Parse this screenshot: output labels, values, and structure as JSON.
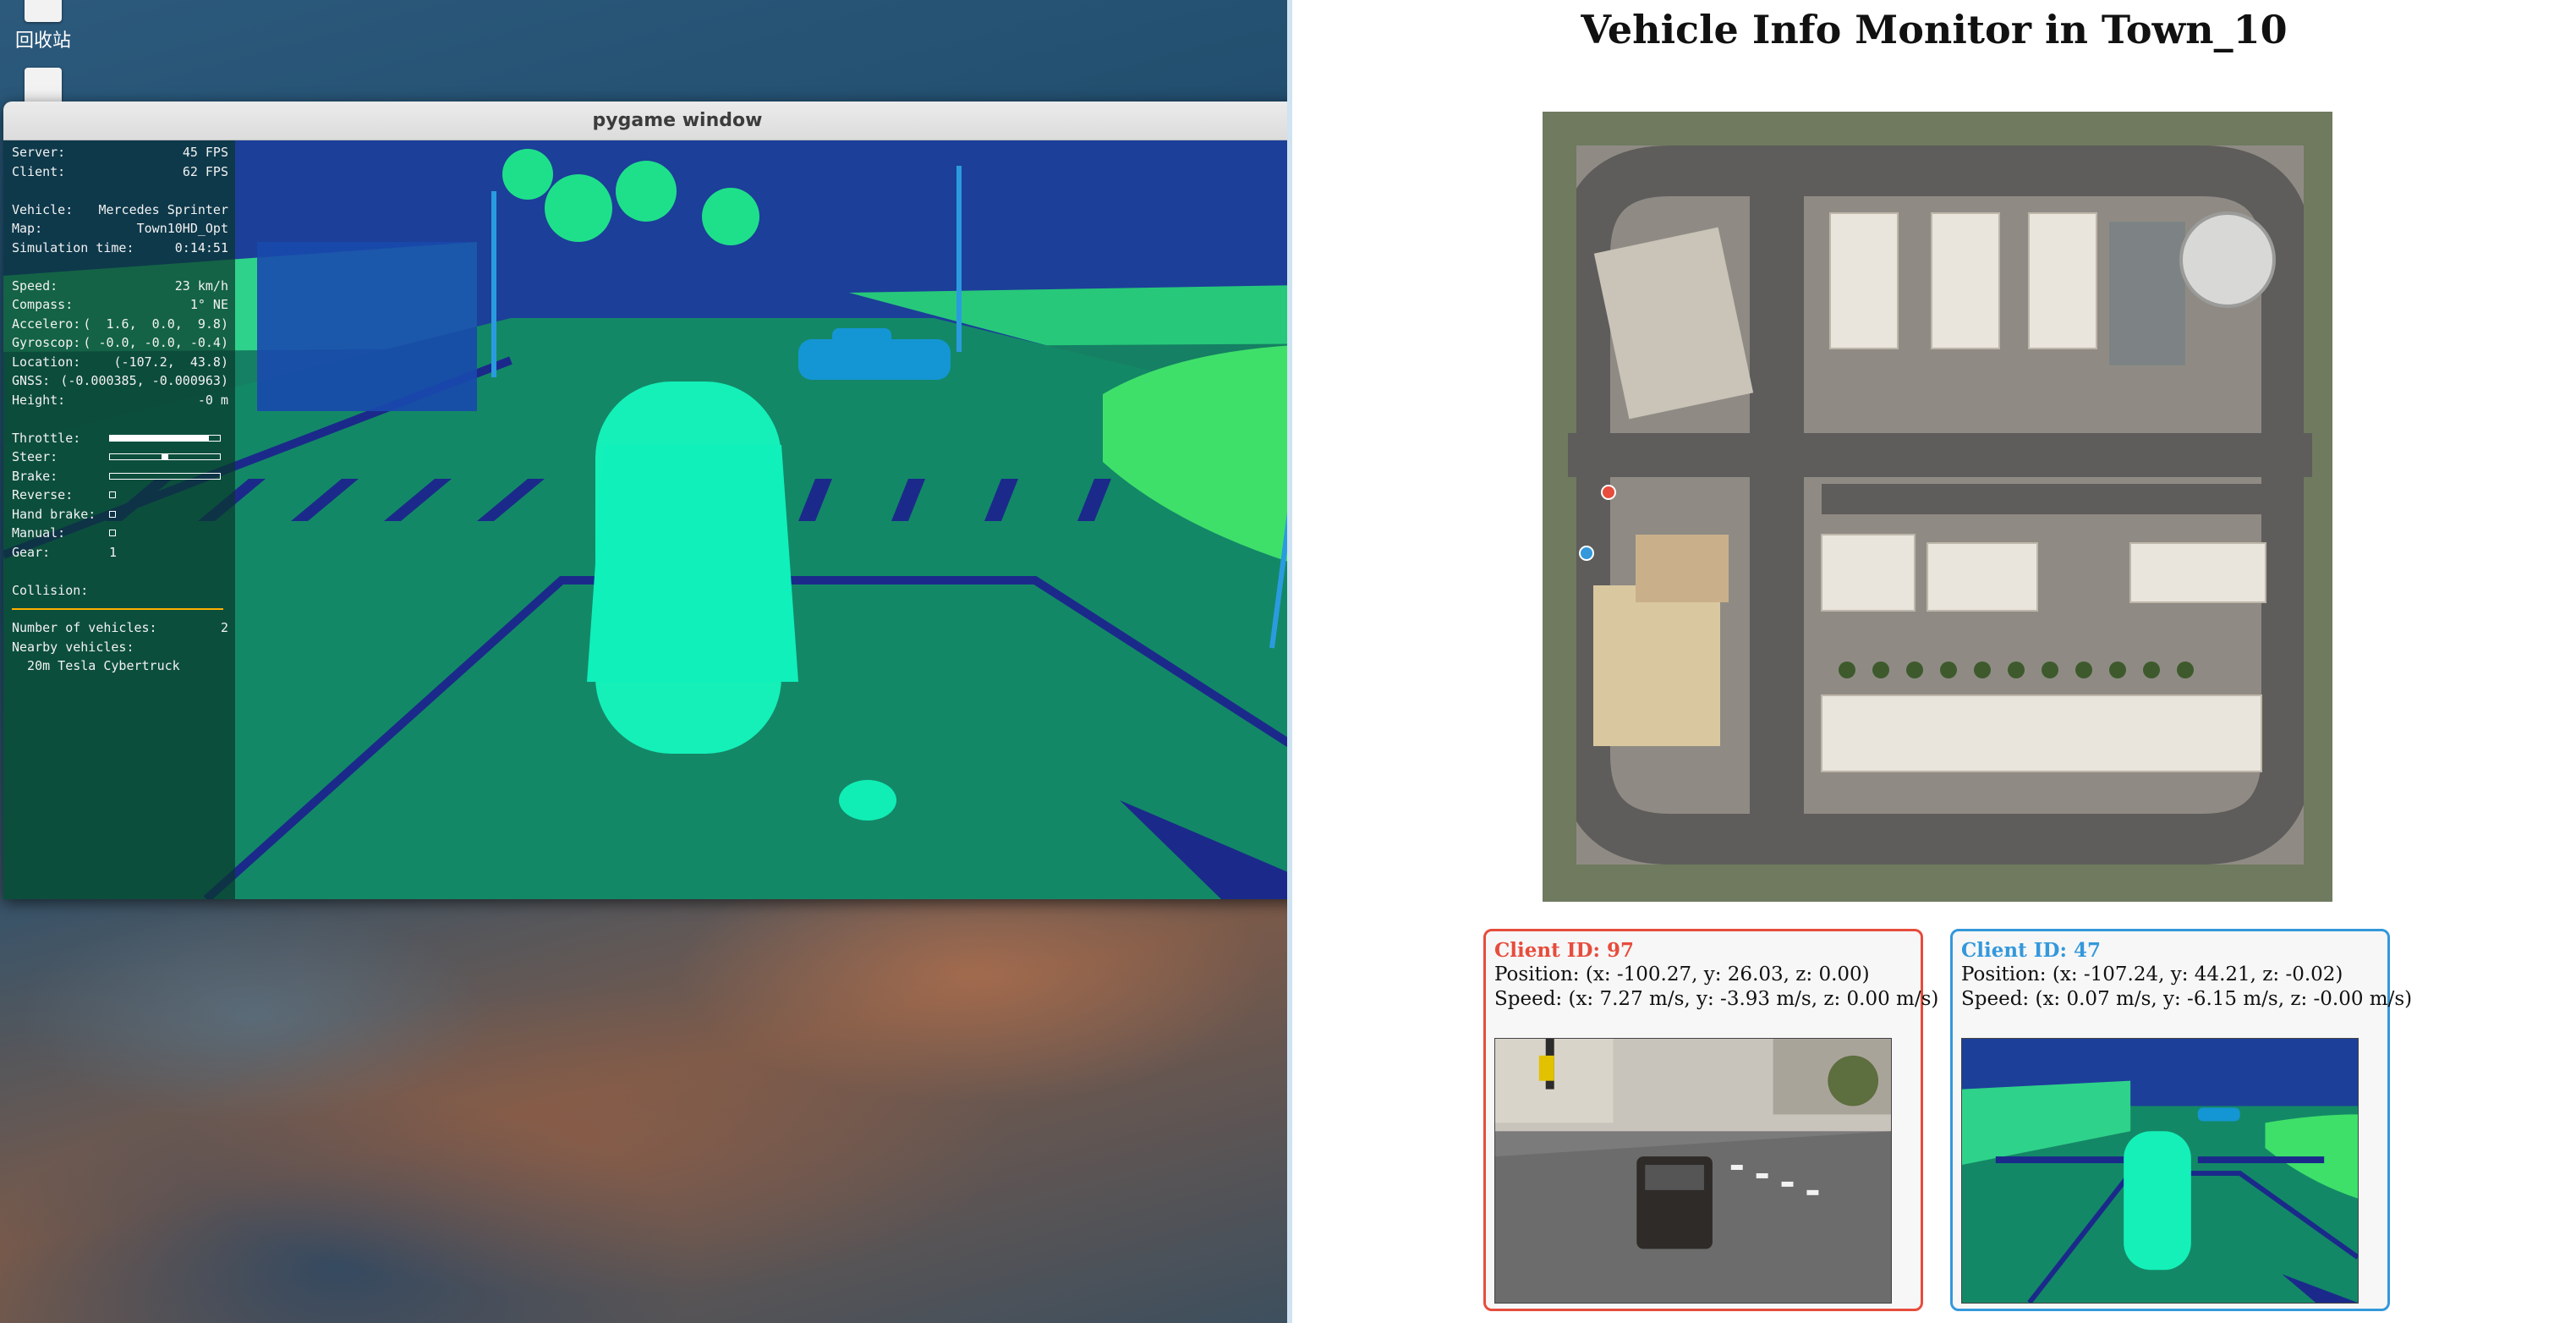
{
  "desktop": {
    "icons": [
      {
        "label": "回收站",
        "icon": "trash-icon"
      },
      {
        "label": "",
        "icon": "file-icon"
      }
    ]
  },
  "pygame_window": {
    "title": "pygame window",
    "minimize": "–",
    "close": "×",
    "hud": {
      "server_label": "Server:",
      "server_value": "45 FPS",
      "client_label": "Client:",
      "client_value": "62 FPS",
      "vehicle_label": "Vehicle:",
      "vehicle_value": "Mercedes Sprinter",
      "map_label": "Map:",
      "map_value": "Town10HD_Opt",
      "simtime_label": "Simulation time:",
      "simtime_value": "0:14:51",
      "speed_label": "Speed:",
      "speed_value": "23 km/h",
      "compass_label": "Compass:",
      "compass_value": "1° NE",
      "accelero_label": "Accelero:",
      "accelero_value": "(  1.6,  0.0,  9.8)",
      "gyroscop_label": "Gyroscop:",
      "gyroscop_value": "( -0.0, -0.0, -0.4)",
      "location_label": "Location:",
      "location_value": "(-107.2,  43.8)",
      "gnss_label": "GNSS:",
      "gnss_value": "(-0.000385, -0.000963)",
      "height_label": "Height:",
      "height_value": "-0 m",
      "throttle_label": "Throttle:",
      "throttle_level": 0.9,
      "steer_label": "Steer:",
      "steer_level": 0.5,
      "brake_label": "Brake:",
      "brake_level": 0.0,
      "reverse_label": "Reverse:",
      "handbrake_label": "Hand brake:",
      "manual_label": "Manual:",
      "gear_label": "Gear:",
      "gear_value": "1",
      "collision_label": "Collision:",
      "num_vehicles_label": "Number of vehicles:",
      "num_vehicles_value": "2",
      "nearby_label": "Nearby vehicles:",
      "nearby_item": "  20m Tesla Cybertruck"
    }
  },
  "monitor": {
    "title": "Vehicle Info Monitor in Town_10",
    "map_markers": [
      {
        "client": "97",
        "color": "#e74c3c"
      },
      {
        "client": "47",
        "color": "#3498db"
      }
    ],
    "clients": [
      {
        "id_text": "Client ID: 97",
        "position": "Position: (x: -100.27, y: 26.03, z: 0.00)",
        "speed": "Speed: (x: 7.27 m/s, y: -3.93 m/s, z: 0.00 m/s)",
        "color": "#e74c3c"
      },
      {
        "id_text": "Client ID: 47",
        "position": "Position: (x: -107.24, y: 44.21, z: -0.02)",
        "speed": "Speed: (x: 0.07 m/s, y: -6.15 m/s, z: -0.00 m/s)",
        "color": "#3498db"
      }
    ]
  }
}
